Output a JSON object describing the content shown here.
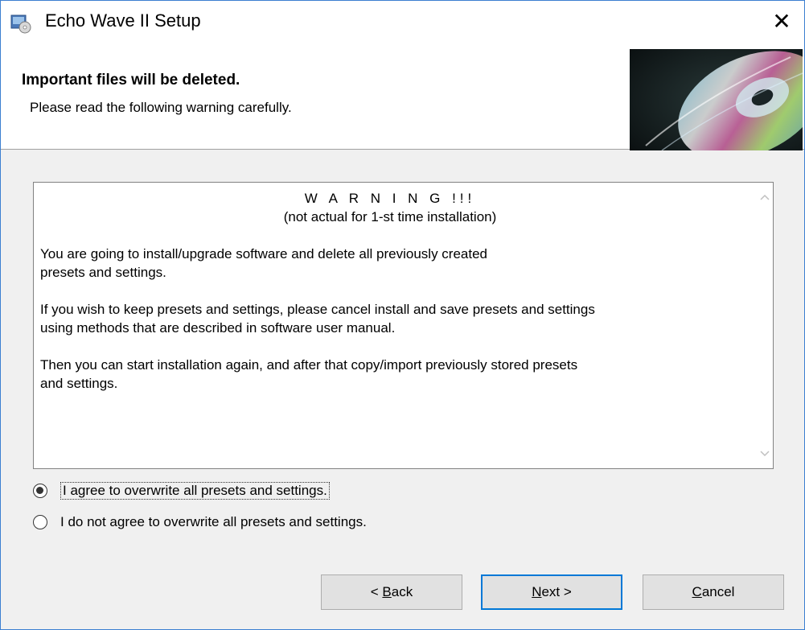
{
  "window": {
    "title": "Echo Wave II Setup",
    "close_glyph": "✕"
  },
  "header": {
    "title": "Important files will be deleted.",
    "subtitle": "Please read the following warning carefully.",
    "image_icon": "cd-disc-image"
  },
  "warning": {
    "title": "W A R N I N G !!!",
    "note": "(not actual for 1-st time installation)",
    "paragraphs": [
      "You are going to install/upgrade software and delete all previously created\npresets and settings.",
      "If you wish to keep presets and settings, please cancel install and save presets and settings\nusing methods that are described in software user manual.",
      "Then you can start installation again, and after that copy/import previously stored presets\nand settings."
    ]
  },
  "options": {
    "agree_label": "I agree to overwrite all presets and settings.",
    "disagree_label": "I do not agree to overwrite all presets and settings.",
    "selected": "agree"
  },
  "buttons": {
    "back_prefix": "< ",
    "back_key": "B",
    "back_rest": "ack",
    "next_key": "N",
    "next_rest": "ext >",
    "cancel_key": "C",
    "cancel_rest": "ancel"
  },
  "colors": {
    "window_border": "#3c7fd1",
    "default_button_border": "#0078d7",
    "dialog_bg": "#f0f0f0"
  }
}
